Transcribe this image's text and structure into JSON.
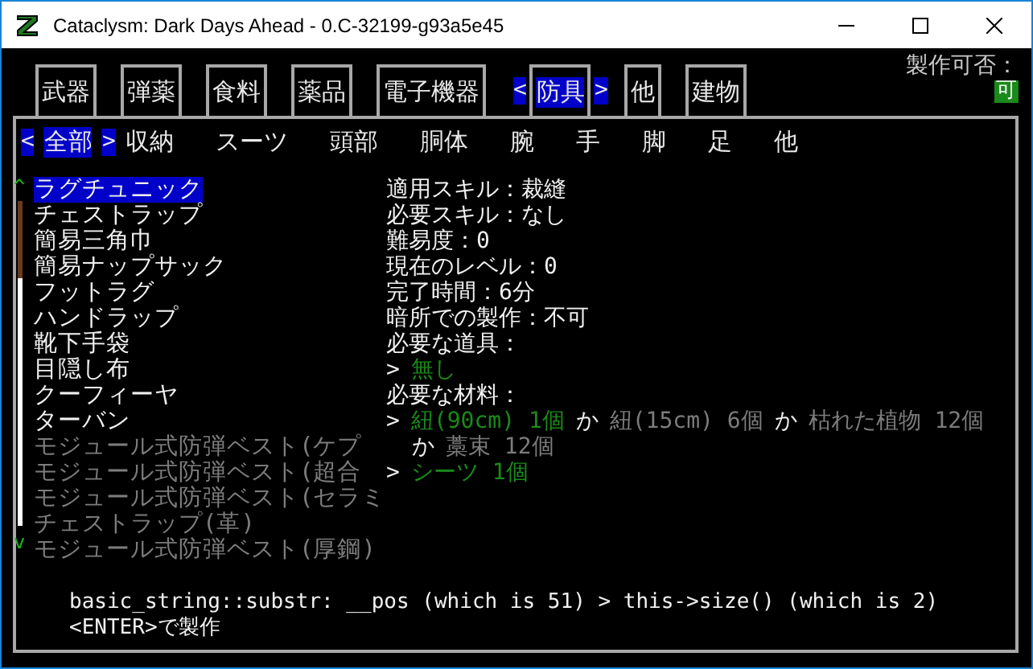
{
  "window": {
    "title": "Cataclysm: Dark Days Ahead - 0.C-32199-g93a5e45"
  },
  "selection_arrows": {
    "left": "<",
    "right": ">"
  },
  "tabs": [
    {
      "label": "武器",
      "selected": false
    },
    {
      "label": "弾薬",
      "selected": false
    },
    {
      "label": "食料",
      "selected": false
    },
    {
      "label": "薬品",
      "selected": false
    },
    {
      "label": "電子機器",
      "selected": false
    },
    {
      "label": "防具",
      "selected": true
    },
    {
      "label": "他",
      "selected": false
    },
    {
      "label": "建物",
      "selected": false
    }
  ],
  "craftable": {
    "label": "製作可否：",
    "value": "可"
  },
  "subtabs": [
    {
      "label": "全部",
      "selected": true
    },
    {
      "label": "収納",
      "selected": false
    },
    {
      "label": "スーツ",
      "selected": false
    },
    {
      "label": "頭部",
      "selected": false
    },
    {
      "label": "胴体",
      "selected": false
    },
    {
      "label": "腕",
      "selected": false
    },
    {
      "label": "手",
      "selected": false
    },
    {
      "label": "脚",
      "selected": false
    },
    {
      "label": "足",
      "selected": false
    },
    {
      "label": "他",
      "selected": false
    }
  ],
  "scroll": {
    "up": "^",
    "down": "v"
  },
  "recipes": [
    {
      "name": "ラグチュニック",
      "selected": true,
      "available": true
    },
    {
      "name": "チェストラップ",
      "selected": false,
      "available": true
    },
    {
      "name": "簡易三角巾",
      "selected": false,
      "available": true
    },
    {
      "name": "簡易ナップサック",
      "selected": false,
      "available": true
    },
    {
      "name": "フットラグ",
      "selected": false,
      "available": true
    },
    {
      "name": "ハンドラップ",
      "selected": false,
      "available": true
    },
    {
      "name": "靴下手袋",
      "selected": false,
      "available": true
    },
    {
      "name": "目隠し布",
      "selected": false,
      "available": true
    },
    {
      "name": "クーフィーヤ",
      "selected": false,
      "available": true
    },
    {
      "name": "ターバン",
      "selected": false,
      "available": true
    },
    {
      "name": "モジュール式防弾ベスト(ケプ",
      "selected": false,
      "available": false
    },
    {
      "name": "モジュール式防弾ベスト(超合",
      "selected": false,
      "available": false
    },
    {
      "name": "モジュール式防弾ベスト(セラミ",
      "selected": false,
      "available": false
    },
    {
      "name": "チェストラップ(革)",
      "selected": false,
      "available": false
    },
    {
      "name": "モジュール式防弾ベスト(厚鋼)",
      "selected": false,
      "available": false
    }
  ],
  "details": [
    {
      "kind": "line",
      "segments": [
        {
          "kind": "plain",
          "text": "適用スキル：裁縫"
        }
      ]
    },
    {
      "kind": "line",
      "segments": [
        {
          "kind": "plain",
          "text": "必要スキル：なし"
        }
      ]
    },
    {
      "kind": "line",
      "segments": [
        {
          "kind": "plain",
          "text": "難易度：0"
        }
      ]
    },
    {
      "kind": "line",
      "segments": [
        {
          "kind": "plain",
          "text": "現在のレベル：0"
        }
      ]
    },
    {
      "kind": "line",
      "segments": [
        {
          "kind": "plain",
          "text": "完了時間：6分"
        }
      ]
    },
    {
      "kind": "line",
      "segments": [
        {
          "kind": "plain",
          "text": "暗所での製作：不可"
        }
      ]
    },
    {
      "kind": "line",
      "segments": [
        {
          "kind": "plain",
          "text": "必要な道具："
        }
      ]
    },
    {
      "kind": "line",
      "segments": [
        {
          "kind": "plain",
          "text": ">"
        },
        {
          "kind": "have",
          "text": "無し"
        }
      ]
    },
    {
      "kind": "line",
      "segments": [
        {
          "kind": "plain",
          "text": "必要な材料："
        }
      ]
    },
    {
      "kind": "line",
      "segments": [
        {
          "kind": "plain",
          "text": ">"
        },
        {
          "kind": "have",
          "text": "紐(90cm) 1個"
        },
        {
          "kind": "plain",
          "text": "か"
        },
        {
          "kind": "lacking",
          "text": "紐(15cm) 6個"
        },
        {
          "kind": "plain",
          "text": "か"
        },
        {
          "kind": "lacking",
          "text": "枯れた植物 12個"
        }
      ]
    },
    {
      "kind": "continuation",
      "segments": [
        {
          "kind": "plain",
          "text": "か"
        },
        {
          "kind": "lacking",
          "text": "藁束 12個"
        }
      ]
    },
    {
      "kind": "line",
      "segments": [
        {
          "kind": "plain",
          "text": ">"
        },
        {
          "kind": "have",
          "text": "シーツ 1個"
        }
      ]
    }
  ],
  "messages": [
    "basic_string::substr: __pos (which is 51) > this->size() (which is 2)",
    "<ENTER>で製作"
  ]
}
